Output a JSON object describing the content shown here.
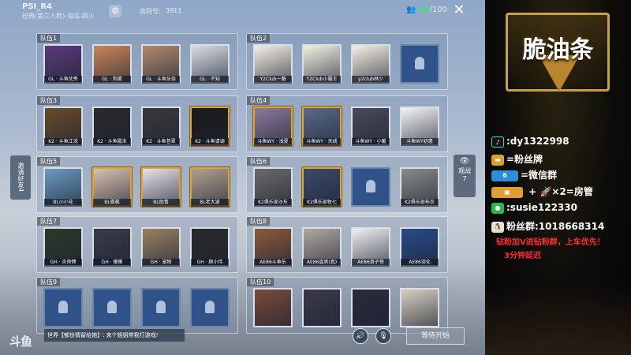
{
  "header": {
    "mode_title": "PSI_R4",
    "mode_sub": "经典(第三人称)-海岛-四人",
    "room_label": "房间号:",
    "room_num": "3911",
    "people_current": "58",
    "people_total": "100"
  },
  "side": {
    "invite": "邀请好友4",
    "watch_label": "观战",
    "watch_count": "7"
  },
  "teams": [
    {
      "label": "队伍1",
      "slots": [
        {
          "name": "GL · 斗鱼优秀",
          "kind": "avatar",
          "color": "#5a3a7a",
          "gold": false
        },
        {
          "name": "GL · 狗蛋",
          "kind": "avatar",
          "color": "#c9865a",
          "gold": false
        },
        {
          "name": "GL · 斗鱼伍佰",
          "kind": "avatar",
          "color": "#b08a70",
          "gold": false
        },
        {
          "name": "GL · 不知",
          "kind": "avatar",
          "color": "#d8dde4",
          "gold": false
        }
      ]
    },
    {
      "label": "队伍2",
      "slots": [
        {
          "name": "Y2Club一路",
          "kind": "avatar",
          "color": "#f3efe2",
          "gold": false
        },
        {
          "name": "Y2Club小霸王",
          "kind": "avatar",
          "color": "#f3efe2",
          "gold": false
        },
        {
          "name": "y2club林少",
          "kind": "avatar",
          "color": "#f3efe2",
          "gold": false
        },
        {
          "name": "",
          "kind": "empty",
          "color": "",
          "gold": false
        }
      ]
    },
    {
      "label": "队伍3",
      "slots": [
        {
          "name": "K2 · 斗鱼江流",
          "kind": "avatar",
          "color": "#6a4a2a",
          "gold": false
        },
        {
          "name": "K2 · 斗鱼殿末",
          "kind": "avatar",
          "color": "#2a2a2a",
          "gold": false
        },
        {
          "name": "K2 · 斗鱼昔翠",
          "kind": "avatar",
          "color": "#3a3a3a",
          "gold": false
        },
        {
          "name": "K2 · 斗鱼请调",
          "kind": "avatar",
          "color": "#1a1a1a",
          "gold": true
        }
      ]
    },
    {
      "label": "队伍4",
      "slots": [
        {
          "name": "斗鱼WY · 浅夏",
          "kind": "avatar",
          "color": "#8a7a9a",
          "gold": true
        },
        {
          "name": "斗鱼WY · 天线",
          "kind": "avatar",
          "color": "#5a6a8a",
          "gold": true
        },
        {
          "name": "斗鱼WY · 小暖",
          "kind": "avatar",
          "color": "#4a4a5a",
          "gold": false
        },
        {
          "name": "斗鱼WY初惠",
          "kind": "avatar",
          "color": "#f5f5f5",
          "gold": false
        }
      ]
    },
    {
      "label": "队伍5",
      "slots": [
        {
          "name": "BL小小花",
          "kind": "avatar",
          "color": "#6a9ac0",
          "gold": false
        },
        {
          "name": "BL枫枫",
          "kind": "avatar",
          "color": "#d8c0b0",
          "gold": true
        },
        {
          "name": "BL助青",
          "kind": "avatar",
          "color": "#e8e0ea",
          "gold": true
        },
        {
          "name": "BL老大波",
          "kind": "avatar",
          "color": "#b0a090",
          "gold": true
        }
      ]
    },
    {
      "label": "队伍6",
      "slots": [
        {
          "name": "K2俱乐部沙东",
          "kind": "avatar",
          "color": "#6a6a6a",
          "gold": false
        },
        {
          "name": "K2俱乐部牧七",
          "kind": "avatar",
          "color": "#3a4a6a",
          "gold": true
        },
        {
          "name": "",
          "kind": "empty",
          "color": "",
          "gold": false
        },
        {
          "name": "K2俱乐部布衣",
          "kind": "avatar",
          "color": "#8a8a8a",
          "gold": false
        }
      ]
    },
    {
      "label": "队伍7",
      "slots": [
        {
          "name": "GH · 炎师傅",
          "kind": "avatar",
          "color": "#2a3a2a",
          "gold": false
        },
        {
          "name": "GH · 傻傻",
          "kind": "avatar",
          "color": "#3a3a4a",
          "gold": false
        },
        {
          "name": "GH · 宠物",
          "kind": "avatar",
          "color": "#9a8060",
          "gold": false
        },
        {
          "name": "GH · 顾小伟",
          "kind": "avatar",
          "color": "#2a2a2a",
          "gold": false
        }
      ]
    },
    {
      "label": "队伍8",
      "slots": [
        {
          "name": "AE86斗鱼乐",
          "kind": "avatar",
          "color": "#8a5a3a",
          "gold": false
        },
        {
          "name": "AE86直男(真)",
          "kind": "avatar",
          "color": "#b0a8a0",
          "gold": false
        },
        {
          "name": "AE86浪子哥",
          "kind": "avatar",
          "color": "#f0f0f0",
          "gold": false
        },
        {
          "name": "AE86羽化",
          "kind": "avatar",
          "color": "#2a4a8a",
          "gold": false
        }
      ]
    },
    {
      "label": "队伍9",
      "slots": [
        {
          "name": "",
          "kind": "empty",
          "color": "",
          "gold": false
        },
        {
          "name": "",
          "kind": "empty",
          "color": "",
          "gold": false
        },
        {
          "name": "",
          "kind": "empty",
          "color": "",
          "gold": false
        },
        {
          "name": "",
          "kind": "empty",
          "color": "",
          "gold": false
        }
      ]
    },
    {
      "label": "队伍10",
      "slots": [
        {
          "name": "",
          "kind": "avatar",
          "color": "#7a4a3a",
          "gold": false
        },
        {
          "name": "",
          "kind": "avatar",
          "color": "#3a3a4a",
          "gold": false
        },
        {
          "name": "",
          "kind": "avatar",
          "color": "#2a2a3a",
          "gold": false
        },
        {
          "name": "",
          "kind": "avatar",
          "color": "#d8d0c0",
          "gold": false
        }
      ]
    }
  ],
  "footer": {
    "logo": "斗鱼",
    "chat": "世界【郁份情留给她】: 来个姐姐带我打游戏!",
    "start_label": "等待开始"
  },
  "overlay": {
    "brand": "脆油条",
    "douyin": ":dy1322998",
    "fans_badge": "=粉丝牌",
    "wechat_group": "=微信群",
    "rocket": "×2=房管",
    "wechat_id": ":susie122330",
    "fans_group": "粉丝群:1018668314",
    "note1": "钻粉加V进钻粉群，上车优先！",
    "note2": "3分钟延迟"
  }
}
